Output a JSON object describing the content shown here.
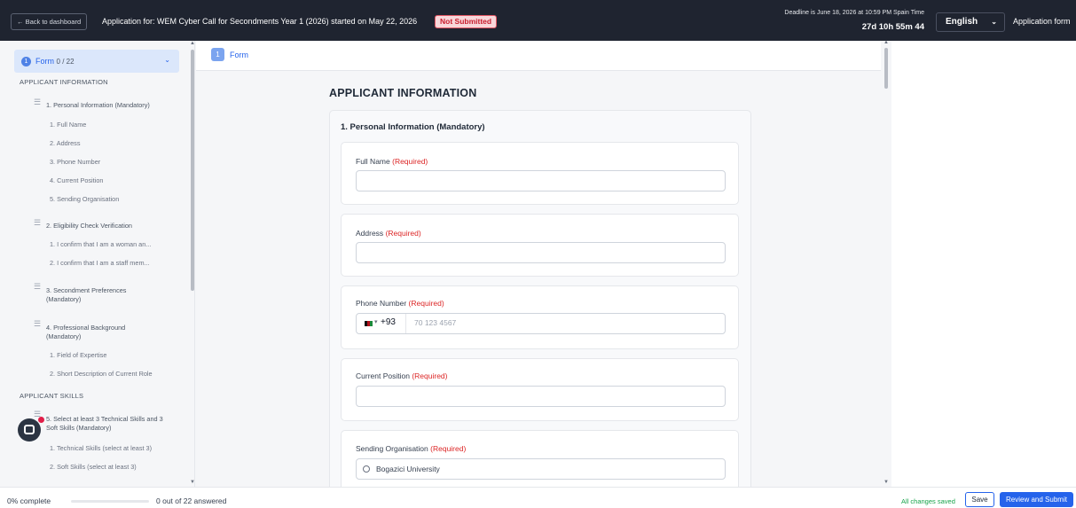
{
  "topbar": {
    "back_label": "← Back to dashboard",
    "app_title": "Application for: WEM Cyber Call for Secondments Year 1 (2026) started on May 22, 2026",
    "status_badge": "Not Submitted",
    "deadline": "Deadline is June 18, 2026 at 10:59 PM Spain Time",
    "countdown": "27d 10h 55m 44",
    "language": "English",
    "app_form_label": "Application form"
  },
  "sidebar": {
    "form_label": "Form",
    "form_number": "1",
    "form_count": "0 / 22",
    "sections": [
      {
        "title": "APPLICANT INFORMATION"
      },
      {
        "title": "APPLICANT SKILLS"
      }
    ],
    "groups": [
      {
        "label": "1. Personal Information (Mandatory)",
        "items": [
          "1.  Full Name",
          "2.  Address",
          "3.  Phone Number",
          "4.  Current Position",
          "5.  Sending Organisation"
        ]
      },
      {
        "label": "2. Eligibility Check Verification",
        "items": [
          "1.  I confirm that I am a woman an...",
          "2.  I confirm that I am a staff mem..."
        ]
      },
      {
        "label": "3. Secondment Preferences (Mandatory)",
        "items": []
      },
      {
        "label": "4. Professional Background (Mandatory)",
        "items": [
          "1.  Field of Expertise",
          "2.  Short Description of Current Role"
        ]
      },
      {
        "label": "5. Select at least 3 Technical Skills and 3 Soft Skills (Mandatory)",
        "items": [
          "1.  Technical Skills (select at least 3)",
          "2.  Soft Skills (select at least 3)"
        ]
      }
    ]
  },
  "main": {
    "tab_number": "1",
    "tab_label": "Form",
    "section_title": "APPLICANT INFORMATION",
    "group_title": "1. Personal Information (Mandatory)",
    "required_text": "(Required)",
    "questions": [
      {
        "label": "Full Name"
      },
      {
        "label": "Address"
      },
      {
        "label": "Phone Number",
        "dial_code": "+93",
        "placeholder": "70 123 4567"
      },
      {
        "label": "Current Position"
      },
      {
        "label": "Sending Organisation",
        "option": "Bogazici University"
      }
    ]
  },
  "footer": {
    "percent": "0% complete",
    "progress": 0,
    "answered": "0 out of 22 answered",
    "saved": "All changes saved",
    "save_label": "Save",
    "review_label": "Review and Submit"
  },
  "colors": {
    "accent": "#2563eb",
    "topbar": "#1f2430",
    "required": "#dc2626",
    "saved": "#16a34a"
  }
}
